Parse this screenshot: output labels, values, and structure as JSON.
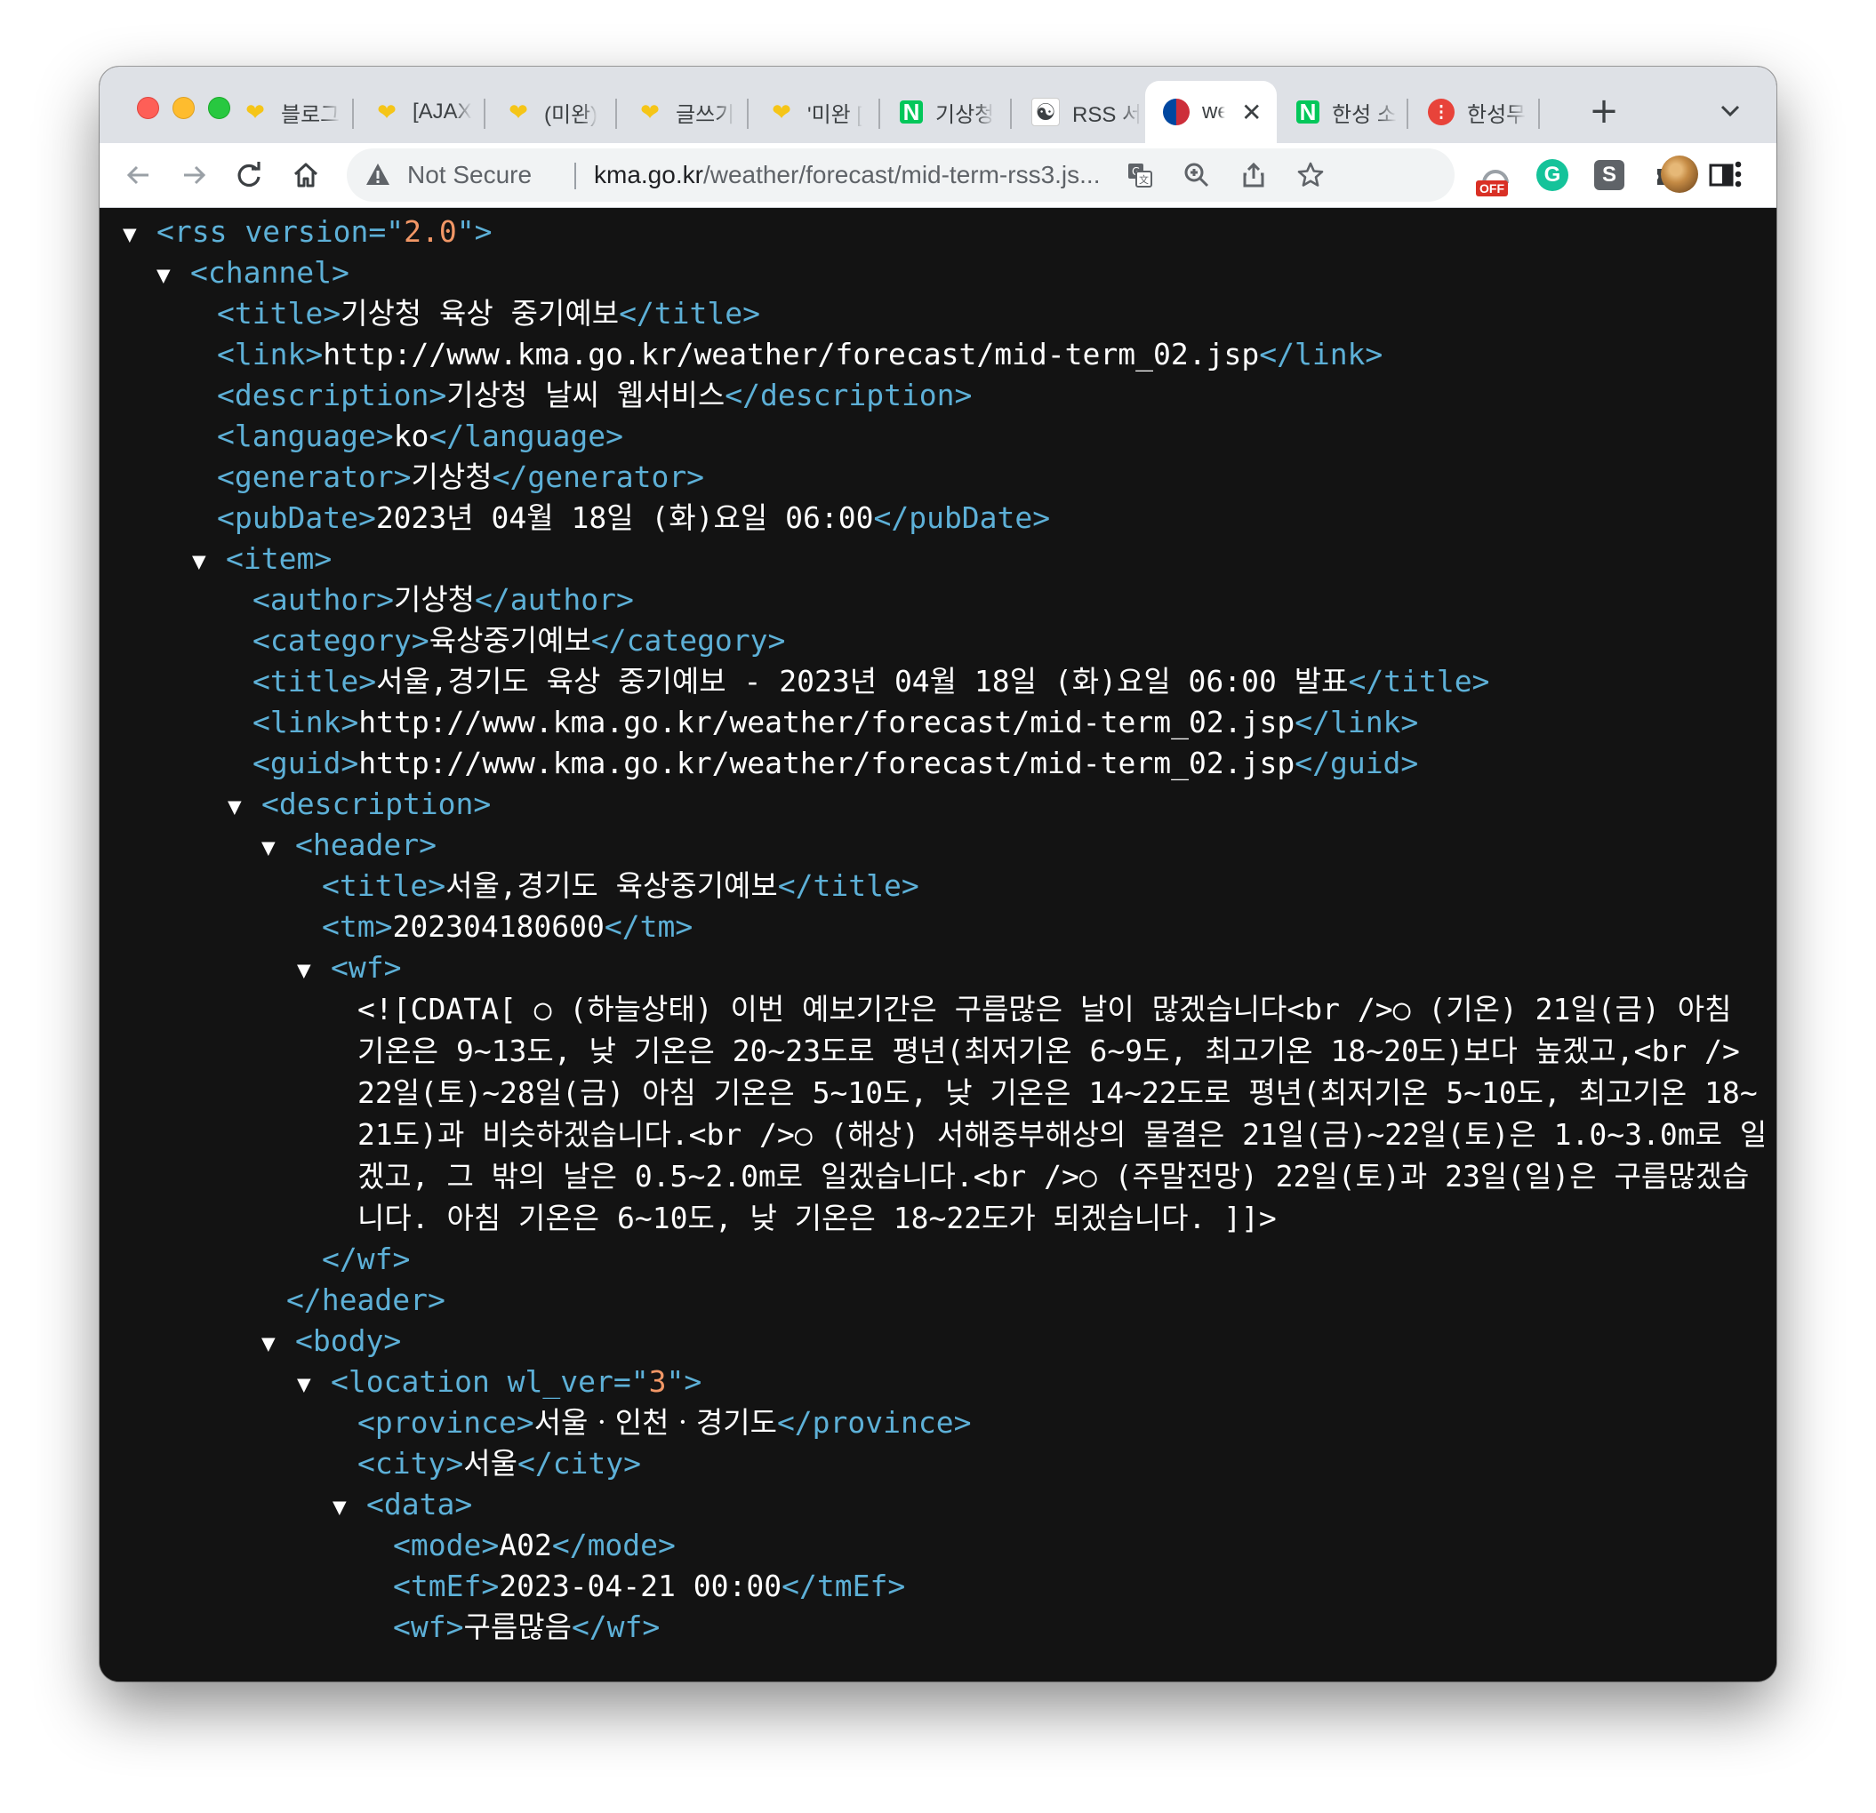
{
  "browser": {
    "tabs": [
      {
        "label": "블로그",
        "favicon": "heart-icon"
      },
      {
        "label": "[AJAX",
        "favicon": "heart-icon"
      },
      {
        "label": "(미완)",
        "favicon": "heart-icon"
      },
      {
        "label": "글쓰기",
        "favicon": "heart-icon"
      },
      {
        "label": "'미완 [",
        "favicon": "heart-icon"
      },
      {
        "label": "기상청",
        "favicon": "naver-icon"
      },
      {
        "label": "RSS 서",
        "favicon": "gov-icon"
      },
      {
        "label": "wea",
        "favicon": "kma-icon",
        "active": true
      },
      {
        "label": "한성 소",
        "favicon": "naver-icon"
      },
      {
        "label": "한성무",
        "favicon": "hs-icon"
      }
    ],
    "tab_close_glyph": "✕",
    "new_tab_glyph": "+",
    "favicon_naver_letter": "N",
    "favicon_gov_glyph": "☯",
    "favicon_hs_glyph": "⁝",
    "address": {
      "security_label": "Not Secure",
      "url_host": "kma.go.kr",
      "url_path": "/weather/forecast/mid-term-rss3.js..."
    },
    "extensions": {
      "off_badge": "OFF",
      "grammarly_letter": "G",
      "s_letter": "S"
    }
  },
  "xml": {
    "rss_open": "<rss version=\"",
    "rss_version": "2.0",
    "rss_close_bracket": "\">",
    "channel": "<channel>",
    "title_open": "<title>",
    "title_close": "</title>",
    "channel_title": "기상청 육상 중기예보",
    "link_open": "<link>",
    "link_close": "</link>",
    "channel_link": "http://www.kma.go.kr/weather/forecast/mid-term_02.jsp",
    "description_open": "<description>",
    "description_close": "</description>",
    "channel_description": "기상청 날씨 웹서비스",
    "language_open": "<language>",
    "language_close": "</language>",
    "language": "ko",
    "generator_open": "<generator>",
    "generator_close": "</generator>",
    "generator": "기상청",
    "pubdate_open": "<pubDate>",
    "pubdate_close": "</pubDate>",
    "pubdate": "2023년 04월 18일 (화)요일 06:00",
    "item": "<item>",
    "author_open": "<author>",
    "author_close": "</author>",
    "author": "기상청",
    "category_open": "<category>",
    "category_close": "</category>",
    "category": "육상중기예보",
    "item_title": "서울,경기도 육상 중기예보 - 2023년 04월 18일 (화)요일 06:00 발표",
    "item_link": "http://www.kma.go.kr/weather/forecast/mid-term_02.jsp",
    "guid_open": "<guid>",
    "guid_close": "</guid>",
    "item_guid": "http://www.kma.go.kr/weather/forecast/mid-term_02.jsp",
    "header_open": "<header>",
    "header_close": "</header>",
    "header_title": "서울,경기도 육상중기예보",
    "tm_open": "<tm>",
    "tm_close": "</tm>",
    "tm": "202304180600",
    "wf_open": "<wf>",
    "wf_close": "</wf>",
    "wf_cdata": "<![CDATA[ ○ (하늘상태) 이번 예보기간은 구름많은 날이 많겠습니다<br />○ (기온) 21일(금) 아침 기온은 9~13도, 낮 기온은 20~23도로 평년(최저기온 6~9도, 최고기온 18~20도)보다 높겠고,<br /> 22일(토)~28일(금) 아침 기온은 5~10도, 낮 기온은 14~22도로 평년(최저기온 5~10도, 최고기온 18~21도)과 비슷하겠습니다.<br />○ (해상) 서해중부해상의 물결은 21일(금)~22일(토)은 1.0~3.0m로 일겠고, 그 밖의 날은 0.5~2.0m로 일겠습니다.<br />○ (주말전망) 22일(토)과 23일(일)은 구름많겠습니다. 아침 기온은 6~10도, 낮 기온은 18~22도가 되겠습니다. ]]>",
    "body_open": "<body>",
    "location_open": "<location wl_ver=\"",
    "location_ver": "3",
    "location_close_bracket": "\">",
    "province_open": "<province>",
    "province_close": "</province>",
    "province": "서울ㆍ인천ㆍ경기도",
    "city_open": "<city>",
    "city_close": "</city>",
    "city": "서울",
    "data_open": "<data>",
    "mode_open": "<mode>",
    "mode_close": "</mode>",
    "mode": "A02",
    "tmef_open": "<tmEf>",
    "tmef_close": "</tmEf>",
    "tmef": "2023-04-21 00:00",
    "wf_value": "구름많음",
    "toggle": "▼"
  },
  "colors": {
    "tag": "#5db0d7",
    "attr_value": "#f29766",
    "text": "#ffffff",
    "background": "#131313"
  }
}
